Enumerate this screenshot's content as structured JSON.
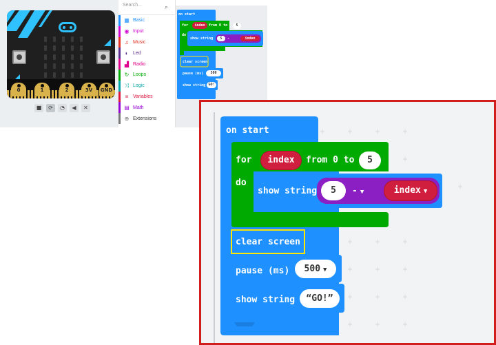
{
  "simulator": {
    "pins": [
      "0",
      "1",
      "2",
      "3V",
      "GND"
    ],
    "controls": [
      {
        "icon": "stop-icon",
        "glyph": "■"
      },
      {
        "icon": "restart-icon",
        "glyph": "⟳"
      },
      {
        "icon": "slowmo-icon",
        "glyph": "◔"
      },
      {
        "icon": "mute-icon",
        "glyph": "◀"
      },
      {
        "icon": "fullscreen-icon",
        "glyph": "✕"
      }
    ]
  },
  "toolbox": {
    "search_placeholder": "Search...",
    "categories": [
      {
        "label": "Basic",
        "color": "#1e90ff",
        "icon": "grid-icon",
        "glyph": "▦"
      },
      {
        "label": "Input",
        "color": "#d400d4",
        "icon": "input-icon",
        "glyph": "◉"
      },
      {
        "label": "Music",
        "color": "#e63022",
        "icon": "headphones-icon",
        "glyph": "♫"
      },
      {
        "label": "Led",
        "color": "#5c2d91",
        "icon": "toggle-icon",
        "glyph": "◐"
      },
      {
        "label": "Radio",
        "color": "#e3008c",
        "icon": "signal-icon",
        "glyph": "▟"
      },
      {
        "label": "Loops",
        "color": "#00aa00",
        "icon": "loop-icon",
        "glyph": "↻"
      },
      {
        "label": "Logic",
        "color": "#00a4a6",
        "icon": "shuffle-icon",
        "glyph": "⤨"
      },
      {
        "label": "Variables",
        "color": "#dc143c",
        "icon": "list-icon",
        "glyph": "≡"
      },
      {
        "label": "Math",
        "color": "#9400d3",
        "icon": "calculator-icon",
        "glyph": "▤"
      },
      {
        "label": "Extensions",
        "color": "#777777",
        "icon": "plus-icon",
        "glyph": "⊕"
      }
    ]
  },
  "program": {
    "on_start": "on start",
    "loop_for": "for",
    "loop_var": "index",
    "loop_from": "from 0 to",
    "loop_to": "5",
    "loop_do": "do",
    "show_string": "show string",
    "minus_left": "5",
    "minus_op": "-",
    "minus_right": "index",
    "clear_screen": "clear screen",
    "pause_label": "pause (ms)",
    "pause_value": "500",
    "show_string_2": "show string",
    "go_text": "GO!"
  },
  "colors": {
    "basic_blue": "#1e90ff",
    "loops_green": "#00aa00",
    "variables_red": "#d01f3e",
    "math_purple": "#8b1fc4",
    "highlight_yellow": "#ffe600",
    "frame_red": "#d21d1d"
  }
}
